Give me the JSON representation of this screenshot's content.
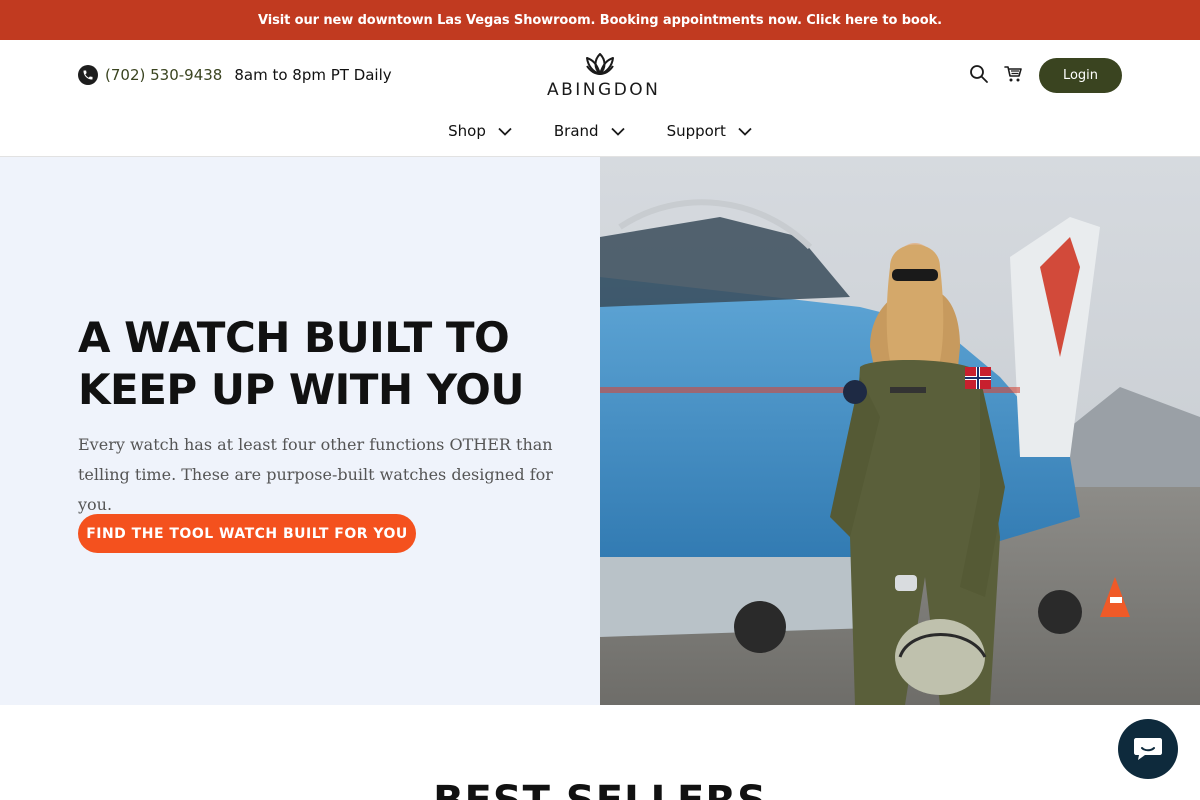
{
  "announcement": {
    "text": "Visit our new downtown Las Vegas Showroom. Booking appointments now. Click here to book."
  },
  "header": {
    "phone": "(702) 530-9438",
    "hours": "8am to 8pm PT Daily",
    "logo_text": "ABINGDON",
    "login_label": "Login",
    "colors": {
      "accent": "#3a4420",
      "announce": "#c13a20"
    }
  },
  "nav": {
    "items": [
      {
        "label": "Shop",
        "icon": "chevron-down-icon"
      },
      {
        "label": "Brand",
        "icon": "chevron-down-icon"
      },
      {
        "label": "Support",
        "icon": "chevron-down-icon"
      }
    ]
  },
  "hero": {
    "title": "A WATCH BUILT TO KEEP UP WITH YOU",
    "text": "Every watch has at least four other functions OTHER than telling time. These are purpose-built watches designed for you.",
    "cta_label": "FIND THE TOOL WATCH BUILT FOR YOU",
    "cta_color": "#f4511e"
  },
  "sections": {
    "best_sellers_title": "BEST SELLERS"
  }
}
